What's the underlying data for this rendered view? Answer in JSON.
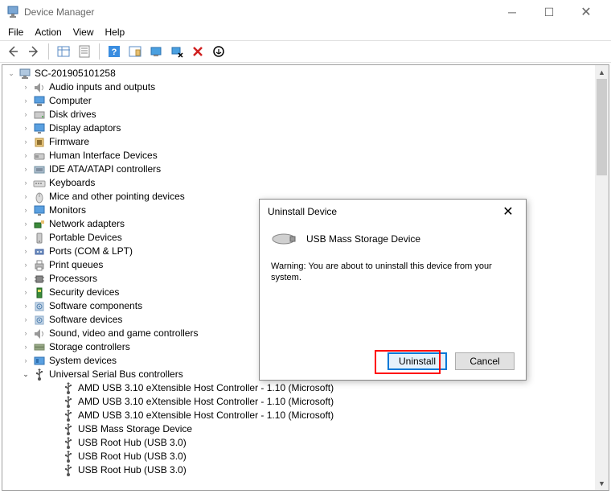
{
  "window": {
    "title": "Device Manager"
  },
  "menu": {
    "file": "File",
    "action": "Action",
    "view": "View",
    "help": "Help"
  },
  "tree": {
    "root": "SC-201905101258",
    "categories": [
      "Audio inputs and outputs",
      "Computer",
      "Disk drives",
      "Display adaptors",
      "Firmware",
      "Human Interface Devices",
      "IDE ATA/ATAPI controllers",
      "Keyboards",
      "Mice and other pointing devices",
      "Monitors",
      "Network adapters",
      "Portable Devices",
      "Ports (COM & LPT)",
      "Print queues",
      "Processors",
      "Security devices",
      "Software components",
      "Software devices",
      "Sound, video and game controllers",
      "Storage controllers",
      "System devices",
      "Universal Serial Bus controllers"
    ],
    "usb_children": [
      "AMD USB 3.10 eXtensible Host Controller - 1.10 (Microsoft)",
      "AMD USB 3.10 eXtensible Host Controller - 1.10 (Microsoft)",
      "AMD USB 3.10 eXtensible Host Controller - 1.10 (Microsoft)",
      "USB Mass Storage Device",
      "USB Root Hub (USB 3.0)",
      "USB Root Hub (USB 3.0)",
      "USB Root Hub (USB 3.0)"
    ]
  },
  "dialog": {
    "title": "Uninstall Device",
    "device": "USB Mass Storage Device",
    "warning": "Warning: You are about to uninstall this device from your system.",
    "uninstall": "Uninstall",
    "cancel": "Cancel"
  }
}
